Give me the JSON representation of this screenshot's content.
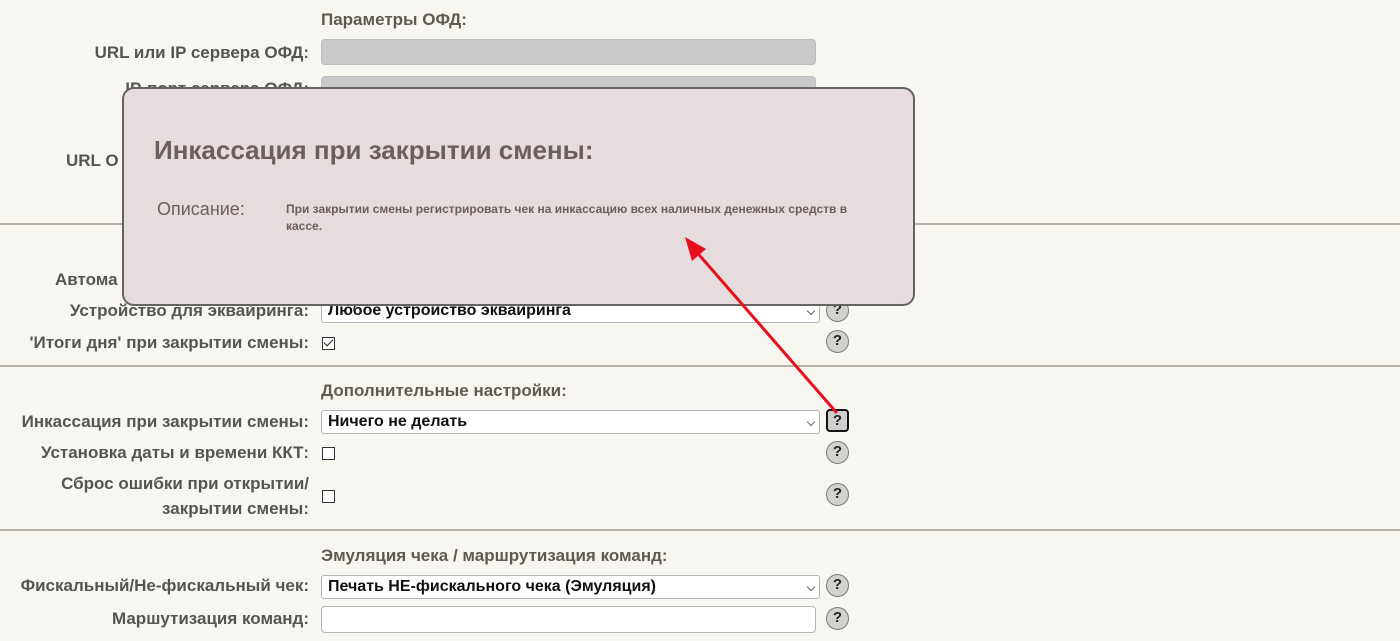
{
  "sections": {
    "ofd": "Параметры ОФД:",
    "extra": "Дополнительные настройки:",
    "emulation": "Эмуляция чека / маршрутизация команд:"
  },
  "fields": {
    "ofd_url_label": "URL или IP сервера ОФД:",
    "ofd_port_label": "IP-порт сервера ОФД:",
    "url_label_partial": "URL О",
    "auto_label_partial": "Автома",
    "acquiring_label": "Устройство для эквайринга:",
    "acquiring_value": "Любое устройство эквайринга",
    "day_totals_label": "'Итоги дня' при закрытии смены:",
    "collection_label": "Инкассация при закрытии смены:",
    "collection_value": "Ничего не делать",
    "datetime_label": "Установка даты и времени ККТ:",
    "reset_error_label_1": "Сброс ошибки при открытии/",
    "reset_error_label_2": "закрытии смены:",
    "fiscal_label": "Фискальный/Не-фискальный чек:",
    "fiscal_value": "Печать НЕ-фискального чека (Эмуляция)",
    "routing_label": "Маршутизация команд:"
  },
  "checkboxes": {
    "day_totals": true,
    "datetime": false,
    "reset_error": false
  },
  "help_glyph": "?",
  "tooltip": {
    "title": "Инкассация при закрытии смены:",
    "description_label": "Описание:",
    "description": "При закрытии смены регистрировать чек на инкассацию всех наличных денежных средств в кассе."
  },
  "colors": {
    "background": "#f8f6f0",
    "tooltip_bg": "#e6dcdd",
    "arrow": "#e8101c"
  }
}
